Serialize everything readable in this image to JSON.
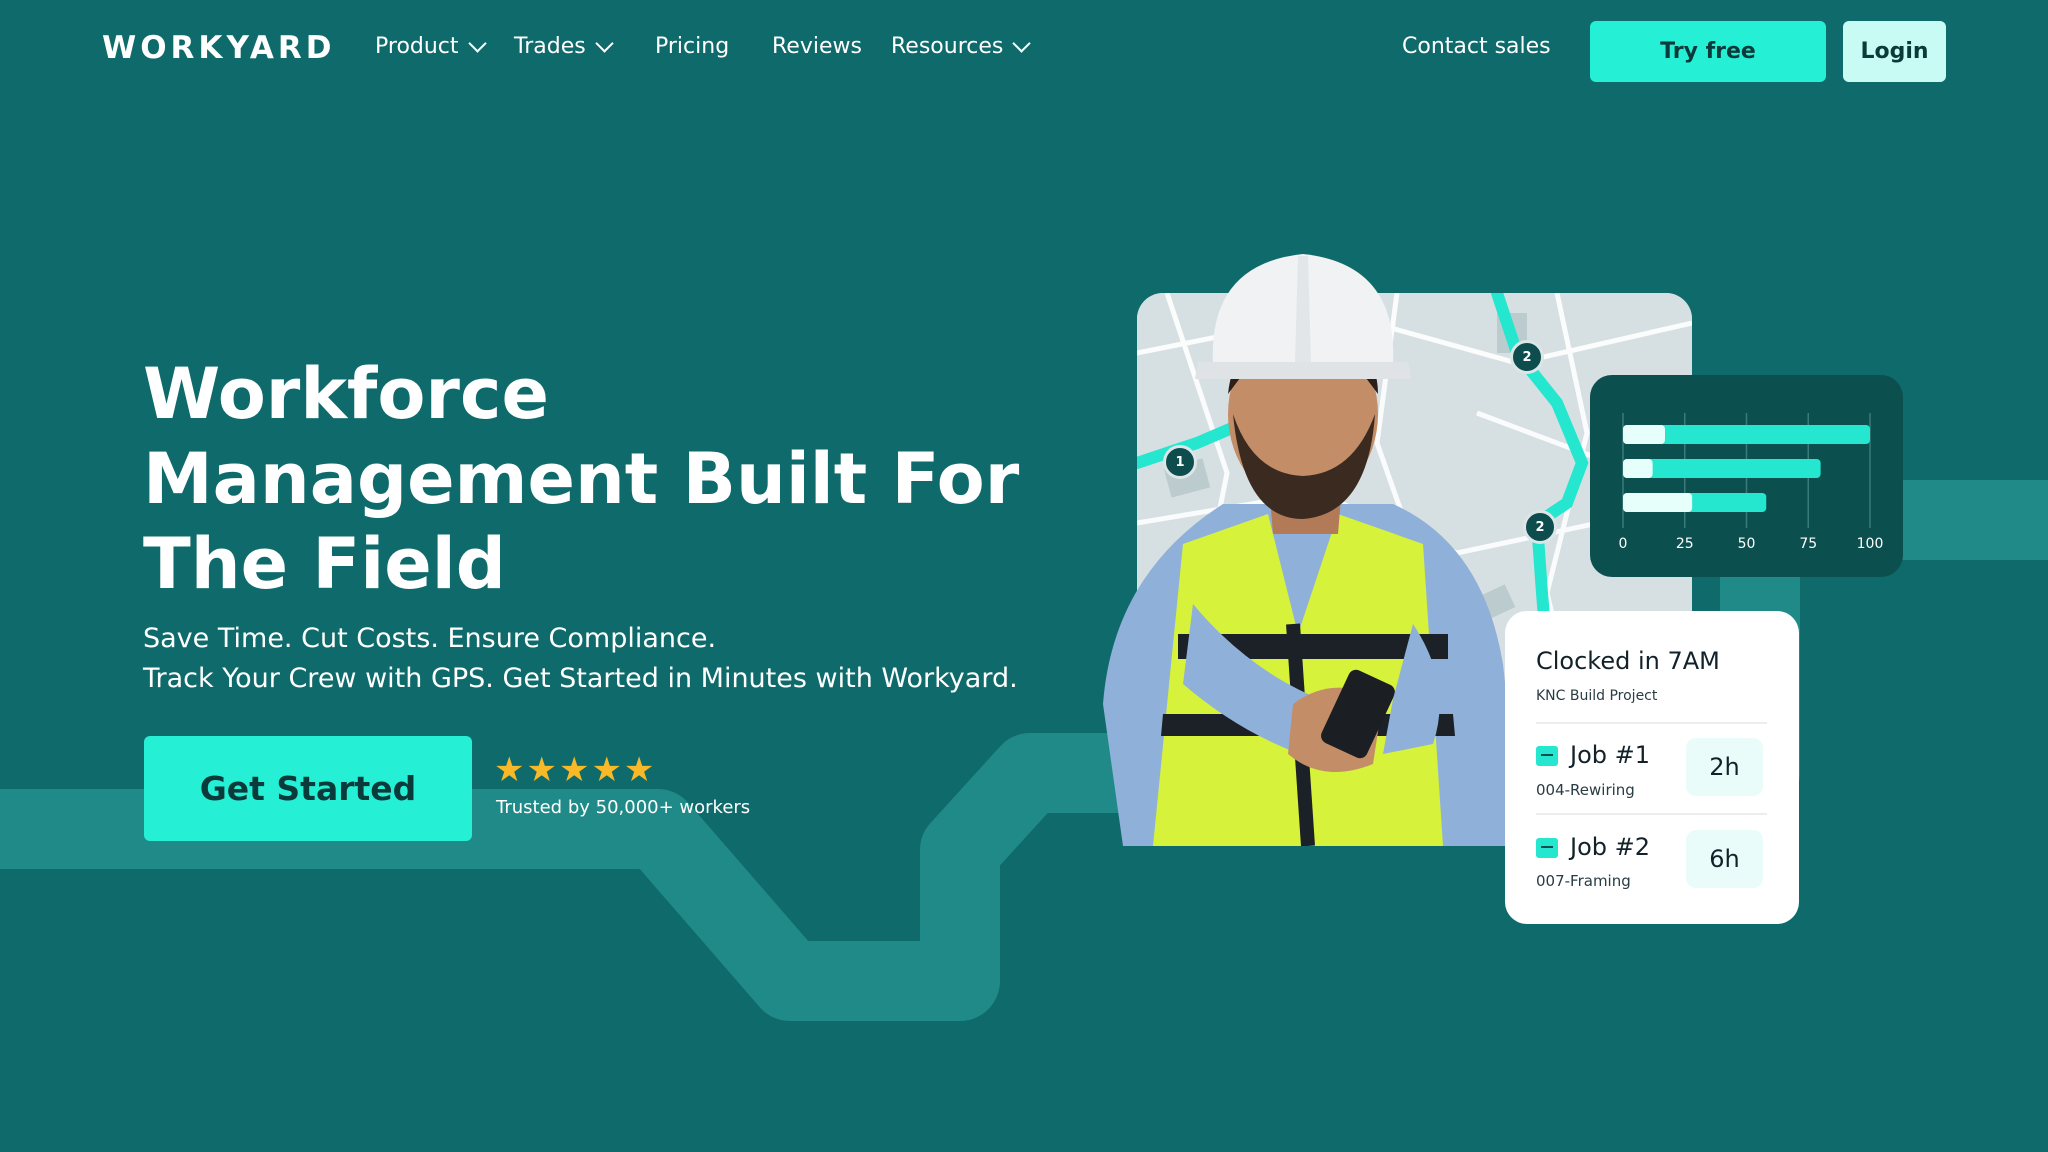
{
  "brand": {
    "logo": "WORKYARD"
  },
  "nav": {
    "items": [
      {
        "label": "Product",
        "dropdown": true
      },
      {
        "label": "Trades",
        "dropdown": true
      },
      {
        "label": "Pricing",
        "dropdown": false
      },
      {
        "label": "Reviews",
        "dropdown": false
      },
      {
        "label": "Resources",
        "dropdown": true
      }
    ],
    "contact_sales": "Contact sales",
    "try_free": "Try free",
    "login": "Login"
  },
  "hero": {
    "title_lines": [
      "Workforce",
      "Management Built For",
      "The Field"
    ],
    "subtitle_lines": [
      "Save Time. Cut Costs. Ensure Compliance.",
      "Track Your Crew with GPS. Get Started in Minutes with Workyard."
    ],
    "cta": "Get Started",
    "stars": "★★★★★",
    "rating": 5,
    "trusted": "Trusted by 50,000+ workers"
  },
  "map": {
    "pins": [
      "1",
      "2",
      "2"
    ]
  },
  "chart_data": {
    "type": "bar",
    "orientation": "horizontal",
    "categories": [
      "",
      "",
      ""
    ],
    "values": [
      100,
      80,
      58
    ],
    "highlight_values": [
      17,
      12,
      28
    ],
    "xlim": [
      0,
      100
    ],
    "xticks": [
      "0",
      "25",
      "50",
      "75",
      "100"
    ],
    "title": "",
    "xlabel": "",
    "ylabel": "",
    "grid": true
  },
  "clock_card": {
    "title": "Clocked in 7AM",
    "project": "KNC Build Project",
    "jobs": [
      {
        "name": "Job #1",
        "code": "004-Rewiring",
        "hours": "2h"
      },
      {
        "name": "Job #2",
        "code": "007-Framing",
        "hours": "6h"
      }
    ]
  },
  "colors": {
    "background": "#0f6b6b",
    "accent": "#25f0d6",
    "path": "#1f8a87",
    "star": "#f7b928"
  },
  "icons": [
    "chevron-down-icon",
    "star-icon",
    "map-pin-icon",
    "job-icon"
  ]
}
